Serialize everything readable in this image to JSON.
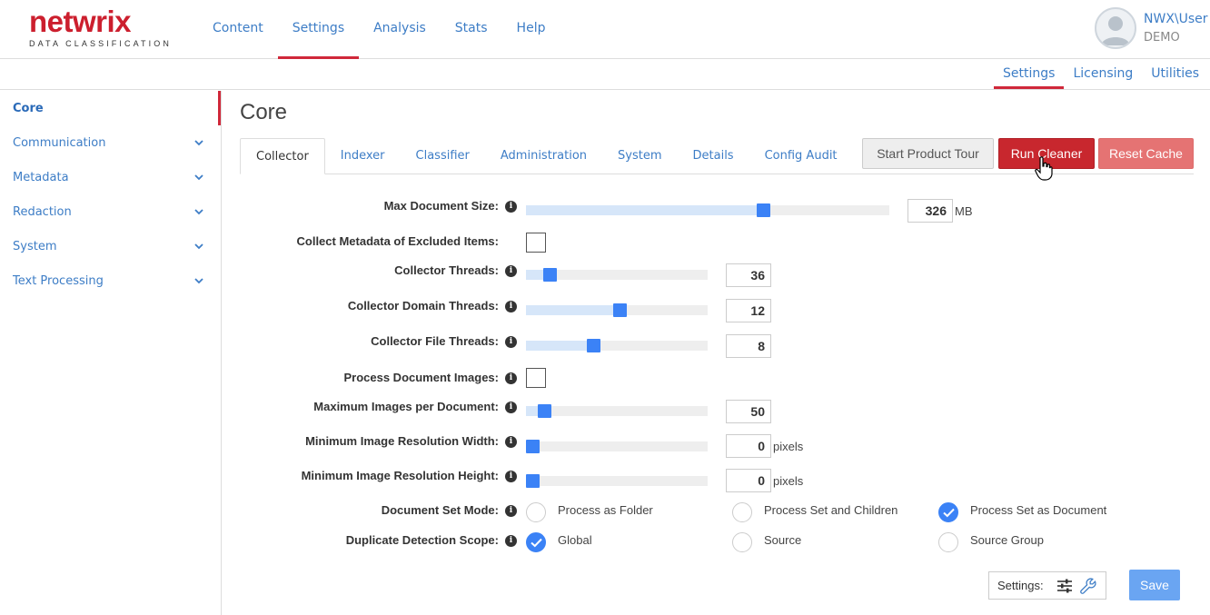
{
  "brand": {
    "name": "netwrix",
    "subtitle": "DATA CLASSIFICATION",
    "color": "#cc1f2e"
  },
  "topnav": [
    {
      "label": "Content"
    },
    {
      "label": "Settings"
    },
    {
      "label": "Analysis"
    },
    {
      "label": "Stats"
    },
    {
      "label": "Help"
    }
  ],
  "user": {
    "name": "NWX\\User",
    "org": "DEMO"
  },
  "subnav": [
    {
      "label": "Settings"
    },
    {
      "label": "Licensing"
    },
    {
      "label": "Utilities"
    }
  ],
  "sidebar": {
    "items": [
      {
        "label": "Core"
      },
      {
        "label": "Communication"
      },
      {
        "label": "Metadata"
      },
      {
        "label": "Redaction"
      },
      {
        "label": "System"
      },
      {
        "label": "Text Processing"
      }
    ]
  },
  "page": {
    "title": "Core"
  },
  "tabs": [
    {
      "label": "Collector"
    },
    {
      "label": "Indexer"
    },
    {
      "label": "Classifier"
    },
    {
      "label": "Administration"
    },
    {
      "label": "System"
    },
    {
      "label": "Details"
    },
    {
      "label": "Config Audit"
    }
  ],
  "actions": {
    "start_tour": "Start Product Tour",
    "run_cleaner": "Run Cleaner",
    "reset_cache": "Reset Cache"
  },
  "form": {
    "max_document_size": {
      "label": "Max Document Size:",
      "value": "326",
      "unit": "MB",
      "slider_fraction": 0.66
    },
    "collect_metadata_excluded": {
      "label": "Collect Metadata of Excluded Items:",
      "checked": false
    },
    "collector_threads": {
      "label": "Collector Threads:",
      "value": "36",
      "slider_fraction": 0.1
    },
    "collector_domain_threads": {
      "label": "Collector Domain Threads:",
      "value": "12",
      "slider_fraction": 0.52
    },
    "collector_file_threads": {
      "label": "Collector File Threads:",
      "value": "8",
      "slider_fraction": 0.36
    },
    "process_document_images": {
      "label": "Process Document Images:",
      "checked": false
    },
    "max_images_per_document": {
      "label": "Maximum Images per Document:",
      "value": "50",
      "slider_fraction": 0.07
    },
    "min_image_resolution_width": {
      "label": "Minimum Image Resolution Width:",
      "value": "0",
      "unit": "pixels",
      "slider_fraction": 0
    },
    "min_image_resolution_height": {
      "label": "Minimum Image Resolution Height:",
      "value": "0",
      "unit": "pixels",
      "slider_fraction": 0
    },
    "document_set_mode": {
      "label": "Document Set Mode:",
      "options": [
        "Process as Folder",
        "Process Set and Children",
        "Process Set as Document"
      ],
      "selected": "Process Set as Document"
    },
    "duplicate_detection_scope": {
      "label": "Duplicate Detection Scope:",
      "options": [
        "Global",
        "Source",
        "Source Group"
      ],
      "selected": "Global"
    }
  },
  "footer": {
    "settings_label": "Settings:",
    "save_label": "Save"
  },
  "icons": {
    "info": "info-icon",
    "chevron": "chevron-down-icon",
    "sliders": "sliders-icon",
    "wrench": "wrench-icon"
  },
  "colors": {
    "accent_red": "#d0283a",
    "link_blue": "#3d7dc6",
    "slider_blue": "#3b82f6"
  }
}
